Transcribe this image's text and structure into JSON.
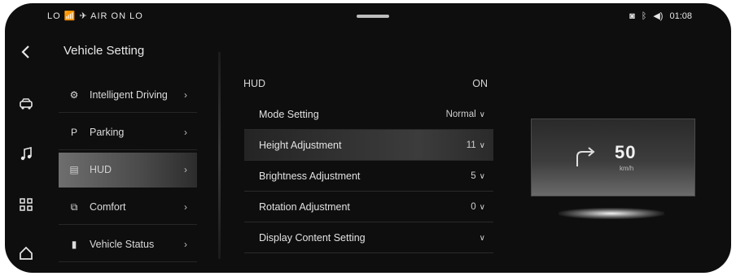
{
  "status": {
    "left_text": "LO 📶 ✈ AIR ON LO",
    "right_icons": [
      "camera-icon",
      "bluetooth-icon",
      "volume-icon"
    ],
    "time": "01:08"
  },
  "sidebar": {
    "title": "Vehicle Setting",
    "items": [
      {
        "label": "Intelligent Driving",
        "icon": "steering-icon"
      },
      {
        "label": "Parking",
        "icon": "parking-icon"
      },
      {
        "label": "HUD",
        "icon": "hud-icon",
        "active": true
      },
      {
        "label": "Comfort",
        "icon": "comfort-icon"
      },
      {
        "label": "Vehicle Status",
        "icon": "vehicle-status-icon"
      }
    ]
  },
  "main": {
    "section_label": "HUD",
    "section_value": "ON",
    "rows": [
      {
        "label": "Mode Setting",
        "value": "Normal"
      },
      {
        "label": "Height Adjustment",
        "value": "11"
      },
      {
        "label": "Brightness Adjustment",
        "value": "5"
      },
      {
        "label": "Rotation Adjustment",
        "value": "0"
      },
      {
        "label": "Display Content Setting",
        "value": ""
      }
    ]
  },
  "preview": {
    "speed": "50",
    "unit": "km/h"
  },
  "colors": {
    "background": "#0e0e0e",
    "active_item": "#5a5a5a",
    "text": "#dcdcdc"
  }
}
